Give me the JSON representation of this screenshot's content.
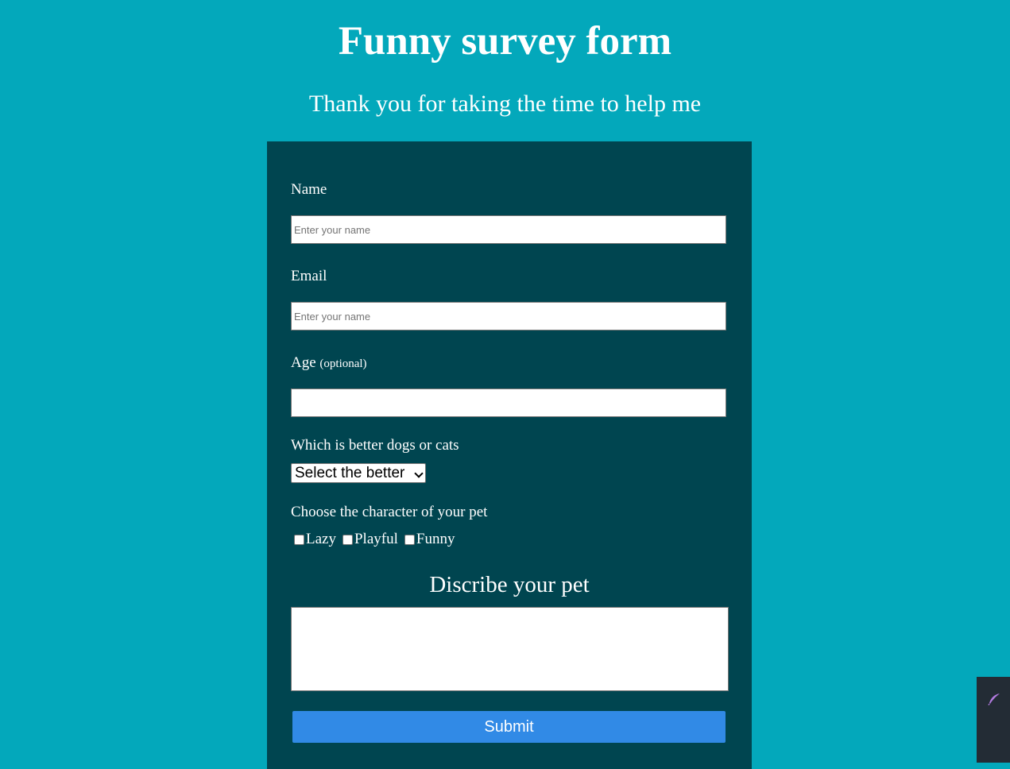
{
  "header": {
    "title": "Funny survey form",
    "subtitle": "Thank you for taking the time to help me"
  },
  "form": {
    "name": {
      "label": "Name",
      "placeholder": "Enter your name"
    },
    "email": {
      "label": "Email",
      "placeholder": "Enter your name"
    },
    "age": {
      "label": "Age",
      "hint": "(optional)"
    },
    "pet_preference": {
      "label": "Which is better dogs or cats",
      "selected": "Select the better"
    },
    "character": {
      "label": "Choose the character of your pet",
      "options": [
        "Lazy",
        "Playful",
        "Funny"
      ]
    },
    "description": {
      "heading": "Discribe your pet"
    },
    "submit_label": "Submit"
  },
  "colors": {
    "background": "#03a8bb",
    "panel": "#004550",
    "button": "#318ae6"
  },
  "extension_widget": {
    "icon": "feather-icon"
  }
}
